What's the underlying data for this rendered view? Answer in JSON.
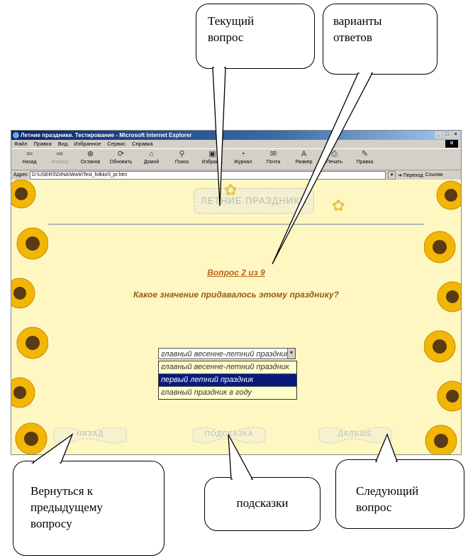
{
  "callouts": {
    "current_question": [
      "Текущий",
      "вопрос"
    ],
    "answer_options": [
      "варианты",
      "ответов"
    ],
    "back": [
      "Вернуться к",
      "предыдущему",
      "вопросу"
    ],
    "hints": "подсказки",
    "next": [
      "Следующий",
      "вопрос"
    ]
  },
  "browser": {
    "title": "Летние праздники. Тестирование - Microsoft Internet Explorer",
    "window_buttons": [
      "_",
      "□",
      "×"
    ],
    "menu": [
      "Файл",
      "Правка",
      "Вид",
      "Избранное",
      "Сервис",
      "Справка"
    ],
    "toolbar": [
      {
        "label": "Назад",
        "icon": "back-arrow-icon"
      },
      {
        "label": "Вперед",
        "icon": "forward-arrow-icon"
      },
      {
        "label": "Останов",
        "icon": "stop-icon"
      },
      {
        "label": "Обновить",
        "icon": "refresh-icon"
      },
      {
        "label": "Домой",
        "icon": "home-icon"
      },
      {
        "label": "Поиск",
        "icon": "search-icon"
      },
      {
        "label": "Избранн.",
        "icon": "favorites-icon"
      },
      {
        "label": "Журнал",
        "icon": "history-icon"
      },
      {
        "label": "Почта",
        "icon": "mail-icon"
      },
      {
        "label": "Размер",
        "icon": "font-size-icon"
      },
      {
        "label": "Печать",
        "icon": "print-icon"
      },
      {
        "label": "Правка",
        "icon": "edit-icon"
      }
    ],
    "address_label": "Адрес",
    "address_value": "D:\\USERS\\DINA\\Work\\Test_folklor\\l_pr.htm",
    "go_label": "Переход",
    "links_label": "Ссылки"
  },
  "page": {
    "banner_title": "ЛЕТНИЕ ПРАЗДНИКИ",
    "question_number": "Вопрос 2 из 9",
    "question_text": "Какое значение придавалось этому празднику?",
    "select_value": "главный весенне-летний праздник",
    "options": [
      "главный весенне-летний праздник",
      "первый летний праздник",
      "главный праздник в году"
    ],
    "selected_index": 1,
    "nav_buttons": {
      "back": "НАЗАД",
      "hint": "ПОДСКАЗКА",
      "next": "ДАЛЬШЕ"
    }
  },
  "colors": {
    "page_background": "#fff7c2",
    "question_color": "#b5651d",
    "selected_option": "#0a1a7a",
    "titlebar": "#0a246a"
  }
}
